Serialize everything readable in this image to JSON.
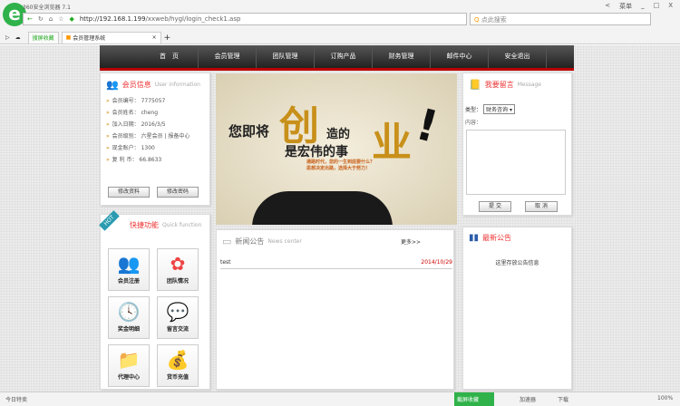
{
  "browser": {
    "title": "360安全浏览器 7.1",
    "url_host": "http://192.168.1.199",
    "url_path": "/xxweb/hygl/login_check1.asp",
    "search_placeholder": "点此搜索",
    "tabs": [
      "搜屏收藏",
      "会员管理系统"
    ],
    "controls": [
      "<",
      "菜单",
      "_",
      "□",
      "X"
    ]
  },
  "nav": [
    "首　页",
    "会员管理",
    "团队管理",
    "订购产品",
    "财务管理",
    "邮件中心",
    "安全退出"
  ],
  "user": {
    "title": "会员信息",
    "title_en": "User information",
    "fields": [
      {
        "k": "会员编号：",
        "v": "7775057"
      },
      {
        "k": "会员姓名：",
        "v": "cheng"
      },
      {
        "k": "加入日期：",
        "v": "2016/3/5"
      },
      {
        "k": "会员级别：",
        "v": "六星会员 | 报备中心"
      },
      {
        "k": "现金账户：",
        "v": "1300"
      },
      {
        "k": "复 利 币：",
        "v": "66.8633"
      }
    ],
    "btn1": "修改资料",
    "btn2": "修改密码"
  },
  "quick": {
    "badge": "HOT",
    "title": "快捷功能",
    "title_en": "Quick function",
    "items": [
      {
        "label": "会员注册",
        "icon": "users-icon",
        "glyph": "👥"
      },
      {
        "label": "团队情况",
        "icon": "flower-icon",
        "glyph": "✿"
      },
      {
        "label": "奖金明细",
        "icon": "clock-icon",
        "glyph": "🕓"
      },
      {
        "label": "留言交流",
        "icon": "chat-icon",
        "glyph": "💬"
      },
      {
        "label": "代理中心",
        "icon": "folder-user-icon",
        "glyph": "📁"
      },
      {
        "label": "货币充值",
        "icon": "money-bag-icon",
        "glyph": "💰"
      }
    ]
  },
  "banner": {
    "line1": "您即将",
    "big1": "创",
    "line2": "造的",
    "line3": "是宏伟的事",
    "big2": "业",
    "sub1": "通路时代，您的一生到底要什么？",
    "sub2": "思想决定出路，选择大于努力！"
  },
  "news": {
    "title": "新闻公告",
    "title_en": "News center",
    "more": "更多>>",
    "items": [
      {
        "title": "test",
        "date": "2014/10/29"
      }
    ]
  },
  "message": {
    "title": "我要留言",
    "title_en": "Message",
    "type_label": "类型：",
    "type_value": "财务咨询",
    "content_label": "内容：",
    "submit": "提 交",
    "cancel": "取 消"
  },
  "notice": {
    "title": "最新公告",
    "text": "这里存放公告信息"
  },
  "status": {
    "left": "今日特卖",
    "items": [
      "截屏收藏",
      "加速器",
      "下载",
      "100%"
    ]
  },
  "colors": {
    "accent": "#e33333",
    "nav": "#333333",
    "navline": "#bb0000",
    "date": "#cc0000"
  }
}
